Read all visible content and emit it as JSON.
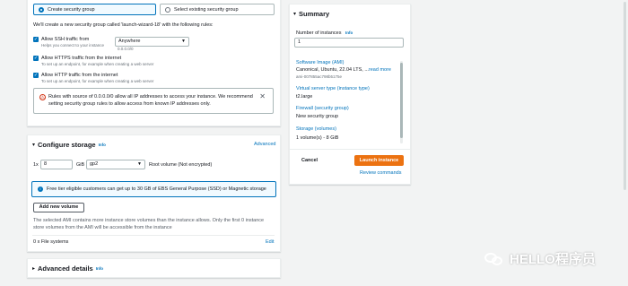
{
  "security_group": {
    "create_label": "Create security group",
    "select_label": "Select existing security group",
    "description": "We'll create a new security group called 'launch-wizard-18' with the following rules:",
    "ssh": {
      "title": "Allow SSH traffic from",
      "sub": "Helps you connect to your instance",
      "source": "Anywhere",
      "source_sub": "0.0.0.0/0"
    },
    "https": {
      "title": "Allow HTTPS traffic from the internet",
      "sub": "To set up an endpoint, for example when creating a web server"
    },
    "http": {
      "title": "Allow HTTP traffic from the internet",
      "sub": "To set up an endpoint, for example when creating a web server"
    },
    "warning": "Rules with source of 0.0.0.0/0 allow all IP addresses to access your instance. We recommend setting security group rules to allow access from known IP addresses only.",
    "warning_icon": "⚠",
    "close_glyph": "✕"
  },
  "storage": {
    "title": "Configure storage",
    "info": "Info",
    "advanced": "Advanced",
    "multiplier": "1x",
    "size": "8",
    "unit": "GiB",
    "volume_type": "gp2",
    "root_label": "Root volume  (Not encrypted)",
    "free_tier": "Free tier eligible customers can get up to 30 GB of EBS General Purpose (SSD) or Magnetic storage",
    "add_volume": "Add new volume",
    "store_note": "The selected AMI contains more instance store volumes than the instance allows. Only the first 0 instance store volumes from the AMI will be accessible from the instance",
    "file_systems": "0 x File systems",
    "edit": "Edit"
  },
  "advanced_details": {
    "title": "Advanced details",
    "info": "Info"
  },
  "summary": {
    "title": "Summary",
    "instances_label": "Number of instances",
    "instances_info": "Info",
    "instances_value": "1",
    "ami_link": "Software Image (AMI)",
    "ami_value": "Canonical, Ubuntu, 22.04 LTS, ...",
    "read_more": "read more",
    "ami_id": "ami-007855ac798b5175e",
    "type_link": "Virtual server type (instance type)",
    "type_value": "t2.large",
    "firewall_link": "Firewall (security group)",
    "firewall_value": "New security group",
    "storage_link": "Storage (volumes)",
    "storage_value": "1 volume(s) - 8 GiB",
    "cancel": "Cancel",
    "launch": "Launch instance",
    "review": "Review commands"
  },
  "watermark": {
    "text": "HELLO程序员"
  },
  "colors": {
    "accent": "#0073bb",
    "primary_button": "#ec7211",
    "warning": "#d13212"
  }
}
